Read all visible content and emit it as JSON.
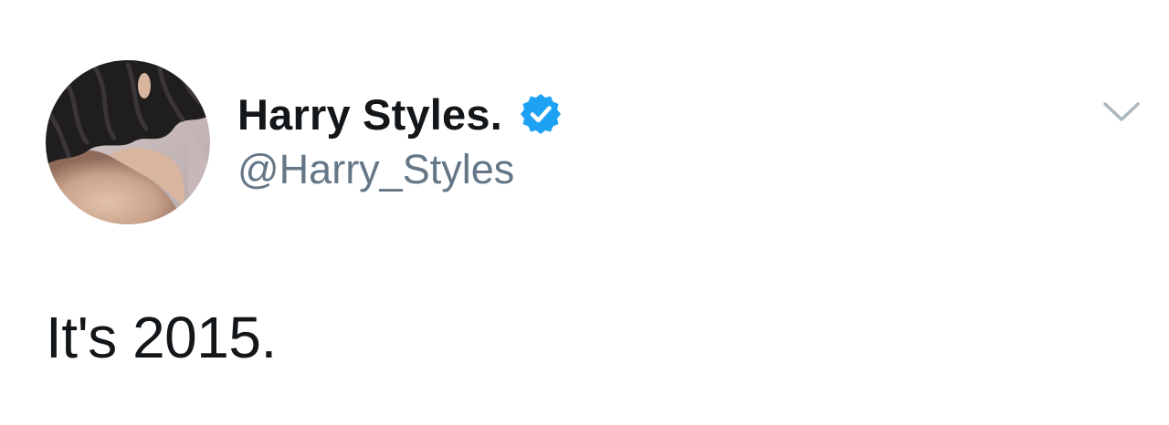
{
  "tweet": {
    "author": {
      "display_name": "Harry Styles.",
      "handle": "@Harry_Styles",
      "verified": true,
      "avatar_icon": "profile-photo"
    },
    "text": "It's 2015.",
    "menu_icon": "chevron-down-icon"
  },
  "colors": {
    "name": "#14171a",
    "handle": "#657786",
    "verified_badge": "#1da1f2",
    "caret": "#aab8c2"
  }
}
